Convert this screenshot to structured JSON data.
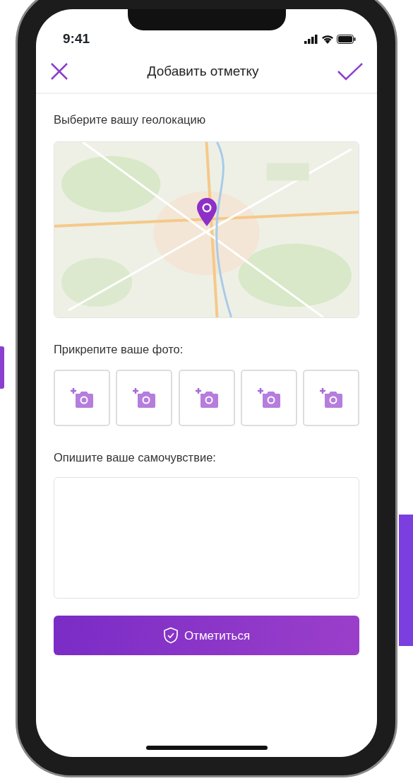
{
  "status_bar": {
    "time": "9:41"
  },
  "header": {
    "title": "Добавить отметку"
  },
  "location": {
    "label": "Выберите вашу геолокацию"
  },
  "photos": {
    "label": "Прикрепите ваше фото:",
    "slots": [
      {
        "kind": "add"
      },
      {
        "kind": "add"
      },
      {
        "kind": "add"
      },
      {
        "kind": "add"
      },
      {
        "kind": "add"
      }
    ]
  },
  "description": {
    "label": "Опишите ваше самочувствие:"
  },
  "submit": {
    "label": "Отметиться"
  }
}
